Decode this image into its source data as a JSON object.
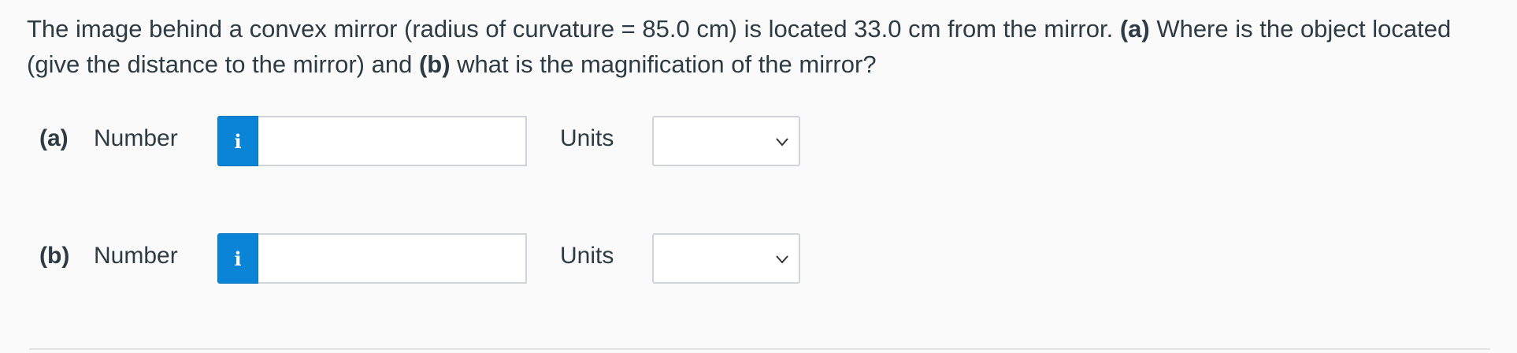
{
  "question": {
    "text_1": "The image behind a convex mirror (radius of curvature = 85.0 cm) is located 33.0 cm from the mirror. ",
    "part_a_marker": "(a)",
    "text_2": " Where is the object located (give the distance to the mirror) and ",
    "part_b_marker": "(b)",
    "text_3": " what is the magnification of the mirror?"
  },
  "answers": [
    {
      "part_label": "(a)",
      "number_label": "Number",
      "info_icon": "i",
      "number_value": "",
      "units_label": "Units",
      "units_selected": ""
    },
    {
      "part_label": "(b)",
      "number_label": "Number",
      "info_icon": "i",
      "number_value": "",
      "units_label": "Units",
      "units_selected": ""
    }
  ],
  "colors": {
    "info_button": "#0a84d6",
    "text": "#2d3b45",
    "border": "#d0d4d8"
  }
}
